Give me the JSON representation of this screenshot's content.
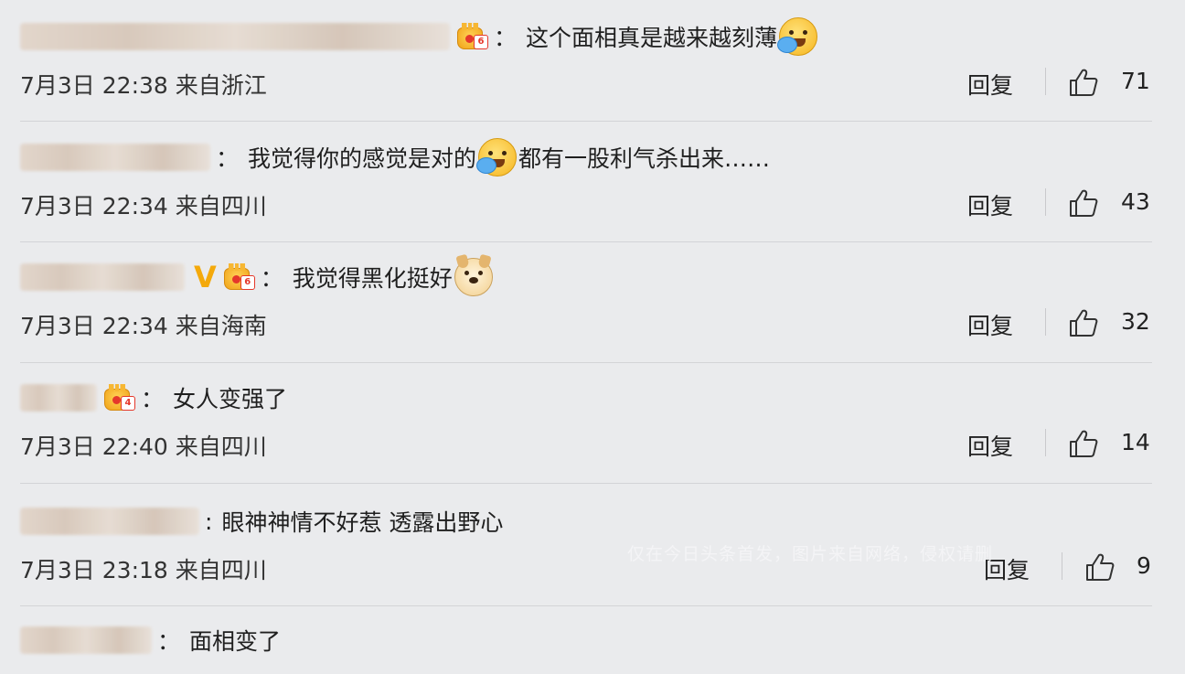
{
  "comments": [
    {
      "text": "这个面相真是越来越刻薄",
      "time": "7月3日 22:38 来自浙江",
      "reply": "回复",
      "likes": "71"
    },
    {
      "text": "我觉得你的感觉是对的",
      "text2": "都有一股利气杀出来……",
      "time": "7月3日 22:34 来自四川",
      "reply": "回复",
      "likes": "43"
    },
    {
      "text": "我觉得黑化挺好",
      "time": "7月3日 22:34 来自海南",
      "reply": "回复",
      "likes": "32"
    },
    {
      "text": "女人变强了",
      "time": "7月3日 22:40 来自四川",
      "reply": "回复",
      "likes": "14"
    },
    {
      "text": "眼神神情不好惹 透露出野心",
      "time": "7月3日 23:18 来自四川",
      "reply": "回复",
      "likes": "9"
    },
    {
      "text": "面相变了"
    }
  ],
  "badges": {
    "level6": "6",
    "level4": "4"
  },
  "colon": "：",
  "colon_half": ":",
  "watermark": "仅在今日头条首发，图片来自网络，侵权请删",
  "icons": {
    "like": "thumbs-up-icon",
    "vip": "vip-v-icon",
    "crown": "crown-level-badge-icon"
  },
  "colors": {
    "background": "#eaebed",
    "vip": "#f4a90b",
    "badge_red": "#e5382b"
  }
}
